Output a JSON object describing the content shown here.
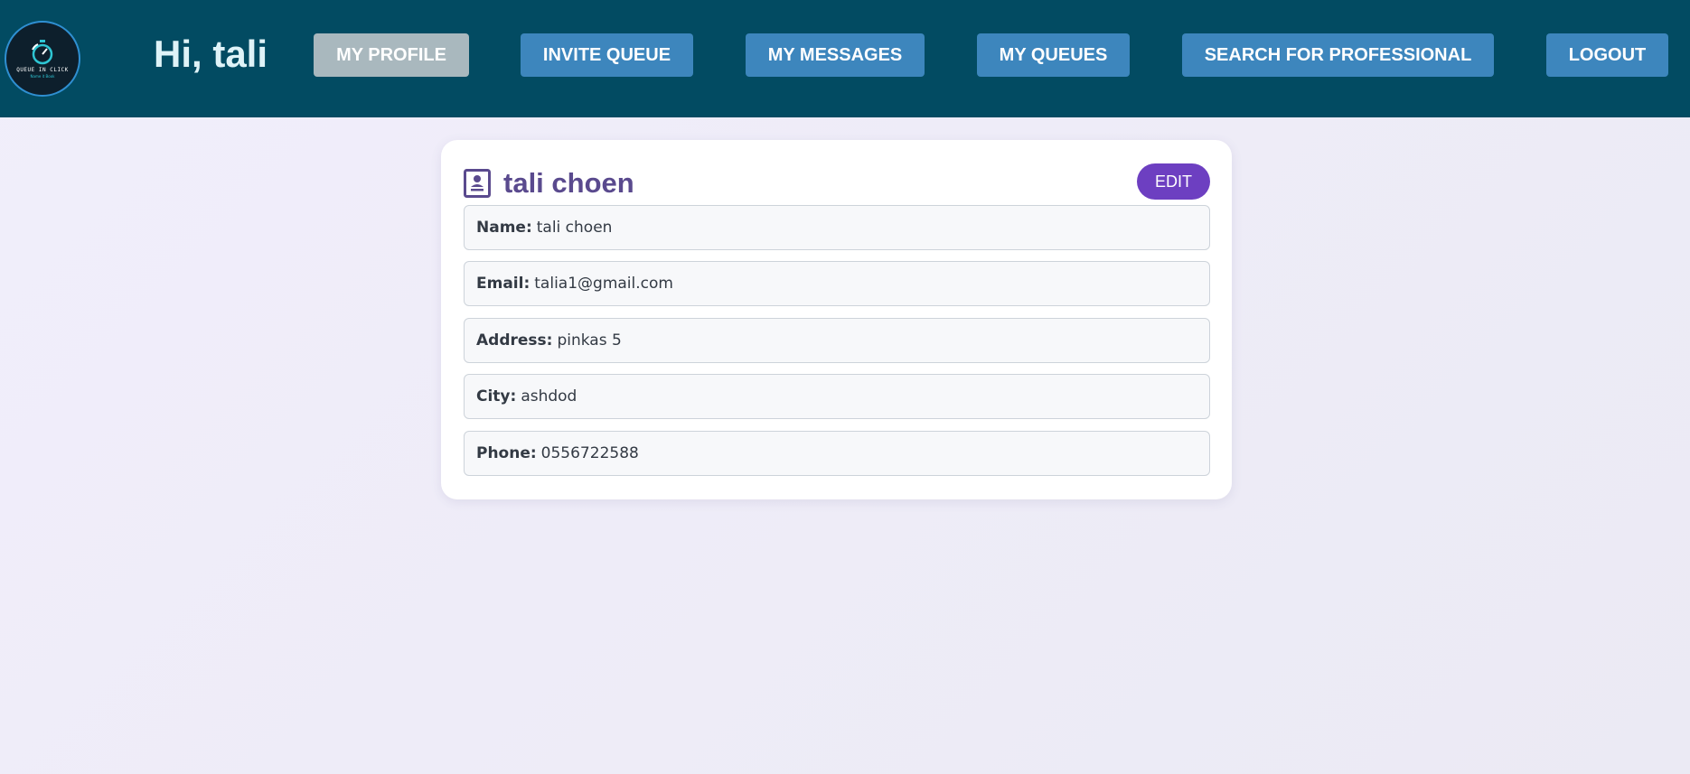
{
  "header": {
    "logo": {
      "icon": "stopwatch-icon",
      "text": "QUEUE IN CLICK",
      "subtext": "Name it Book"
    },
    "greeting": "Hi, tali",
    "nav": [
      {
        "label": "MY PROFILE",
        "active": true
      },
      {
        "label": "INVITE QUEUE",
        "active": false
      },
      {
        "label": "MY MESSAGES",
        "active": false
      },
      {
        "label": "MY QUEUES",
        "active": false
      },
      {
        "label": "SEARCH FOR PROFESSIONAL",
        "active": false
      },
      {
        "label": "LOGOUT",
        "active": false
      }
    ]
  },
  "profile": {
    "title": "tali choen",
    "title_icon": "contact-card-icon",
    "edit_label": "EDIT",
    "fields": [
      {
        "label": "Name:",
        "value": "tali choen"
      },
      {
        "label": "Email:",
        "value": "talia1@gmail.com"
      },
      {
        "label": "Address:",
        "value": "pinkas 5"
      },
      {
        "label": "City:",
        "value": "ashdod"
      },
      {
        "label": "Phone:",
        "value": "0556722588"
      }
    ]
  },
  "colors": {
    "header_bg": "#024b62",
    "nav_button": "#3d86bd",
    "nav_button_active": "#a9b8be",
    "accent_purple": "#6d3fc1",
    "title_purple": "#5a4a8e"
  }
}
